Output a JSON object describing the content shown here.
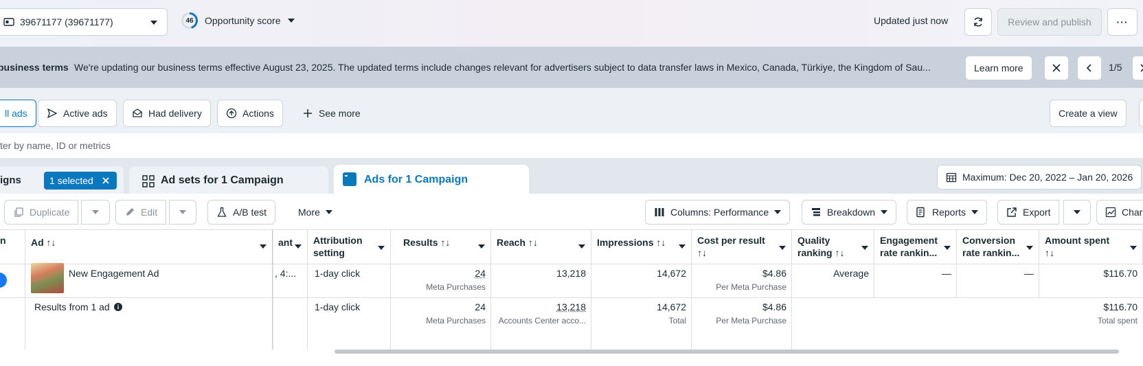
{
  "header": {
    "account": "39671177 (39671177)",
    "score": "46",
    "score_label": "Opportunity score",
    "updated": "Updated just now",
    "review_publish": "Review and publish",
    "more": "···"
  },
  "notice": {
    "title": "business terms",
    "text": "We're updating our business terms effective August 23, 2025. The updated terms include changes relevant for advertisers subject to data transfer laws in Mexico, Canada, Türkiye, the Kingdom of Sau...",
    "learn_more": "Learn more",
    "pager": "1/5"
  },
  "filters": {
    "all_ads": "ll ads",
    "active_ads": "Active ads",
    "had_delivery": "Had delivery",
    "actions": "Actions",
    "see_more": "See more",
    "create_view": "Create a view"
  },
  "search": {
    "placeholder": "ter by name, ID or metrics"
  },
  "tabs": {
    "campaigns": "igns",
    "selected_chip": "1 selected",
    "ad_sets": "Ad sets for 1 Campaign",
    "ads": "Ads for 1 Campaign"
  },
  "date_range": "Maximum: Dec 20, 2022 – Jan 20, 2026",
  "toolbar": {
    "duplicate": "Duplicate",
    "edit": "Edit",
    "ab_test": "A/B test",
    "more": "More",
    "columns": "Columns: Performance",
    "breakdown": "Breakdown",
    "reports": "Reports",
    "export": "Export",
    "charts": "Chart"
  },
  "table": {
    "headers": {
      "col0": "n",
      "ad": "Ad ↑↓",
      "hidden": "ant",
      "attribution": "Attribution setting",
      "results": "Results ↑↓",
      "reach": "Reach ↑↓",
      "impressions": "Impressions ↑↓",
      "cost_per_result": "Cost per result ↑↓",
      "quality": "Quality ranking ↑↓",
      "engagement": "Engagement rate rankin...",
      "conversion": "Conversion rate rankin...",
      "amount_spent": "Amount spent ↑↓"
    },
    "row": {
      "ad_name": "New Engagement Ad",
      "hidden": ", 4:...",
      "attribution": "1-day click",
      "results": "24",
      "results_sub": "Meta Purchases",
      "reach": "13,218",
      "impressions": "14,672",
      "cost": "$4.86",
      "cost_sub": "Per Meta Purchase",
      "quality": "Average",
      "engagement": "—",
      "conversion": "—",
      "amount": "$116.70"
    },
    "summary": {
      "label": "Results from 1 ad",
      "attribution": "1-day click",
      "results": "24",
      "results_sub": "Meta Purchases",
      "reach": "13,218",
      "reach_sub": "Accounts Center acco...",
      "impressions": "14,672",
      "impressions_sub": "Total",
      "cost": "$4.86",
      "cost_sub": "Per Meta Purchase",
      "amount": "$116.70",
      "amount_sub": "Total spent"
    }
  },
  "colors": {
    "accent": "#0a78be",
    "notice_bg": "#c9d2dc",
    "toggle": "#1877f2"
  }
}
